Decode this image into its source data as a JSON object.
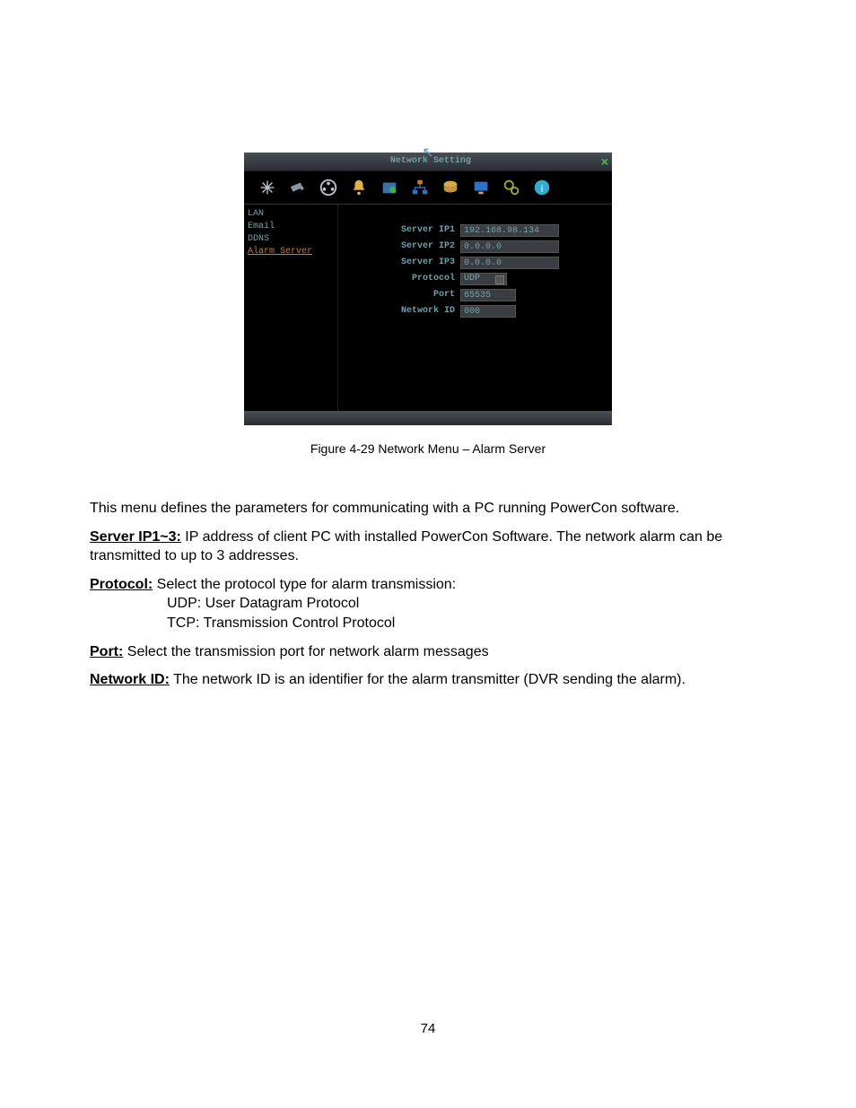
{
  "screenshot": {
    "title": "Network Setting",
    "sidebar": [
      "LAN",
      "Email",
      "DDNS",
      "Alarm Server"
    ],
    "active_sidebar_index": 3,
    "fields": {
      "server_ip1": {
        "label": "Server IP1",
        "value": "192.168.98.134"
      },
      "server_ip2": {
        "label": "Server IP2",
        "value": "0.0.0.0"
      },
      "server_ip3": {
        "label": "Server IP3",
        "value": "0.0.0.0"
      },
      "protocol": {
        "label": "Protocol",
        "value": "UDP"
      },
      "port": {
        "label": "Port",
        "value": "65535"
      },
      "network_id": {
        "label": "Network ID",
        "value": "000"
      }
    }
  },
  "caption": "Figure 4-29 Network Menu – Alarm Server",
  "body": {
    "intro": "This menu defines the parameters for communicating with a PC running PowerCon software.",
    "server_ip_label": "Server IP1~3:",
    "server_ip_text": " IP address of client PC with installed PowerCon Software. The network alarm can be transmitted to up to 3 addresses.",
    "protocol_label": "Protocol:",
    "protocol_text": " Select the protocol type for alarm transmission:",
    "protocol_udp": " UDP: User Datagram Protocol",
    "protocol_tcp": " TCP: Transmission Control Protocol",
    "port_label": "Port:",
    "port_text": " Select the transmission port for network alarm messages",
    "network_id_label": "Network ID:",
    "network_id_text": " The network ID is an identifier for the alarm transmitter (DVR sending the alarm)."
  },
  "page_number": "74"
}
